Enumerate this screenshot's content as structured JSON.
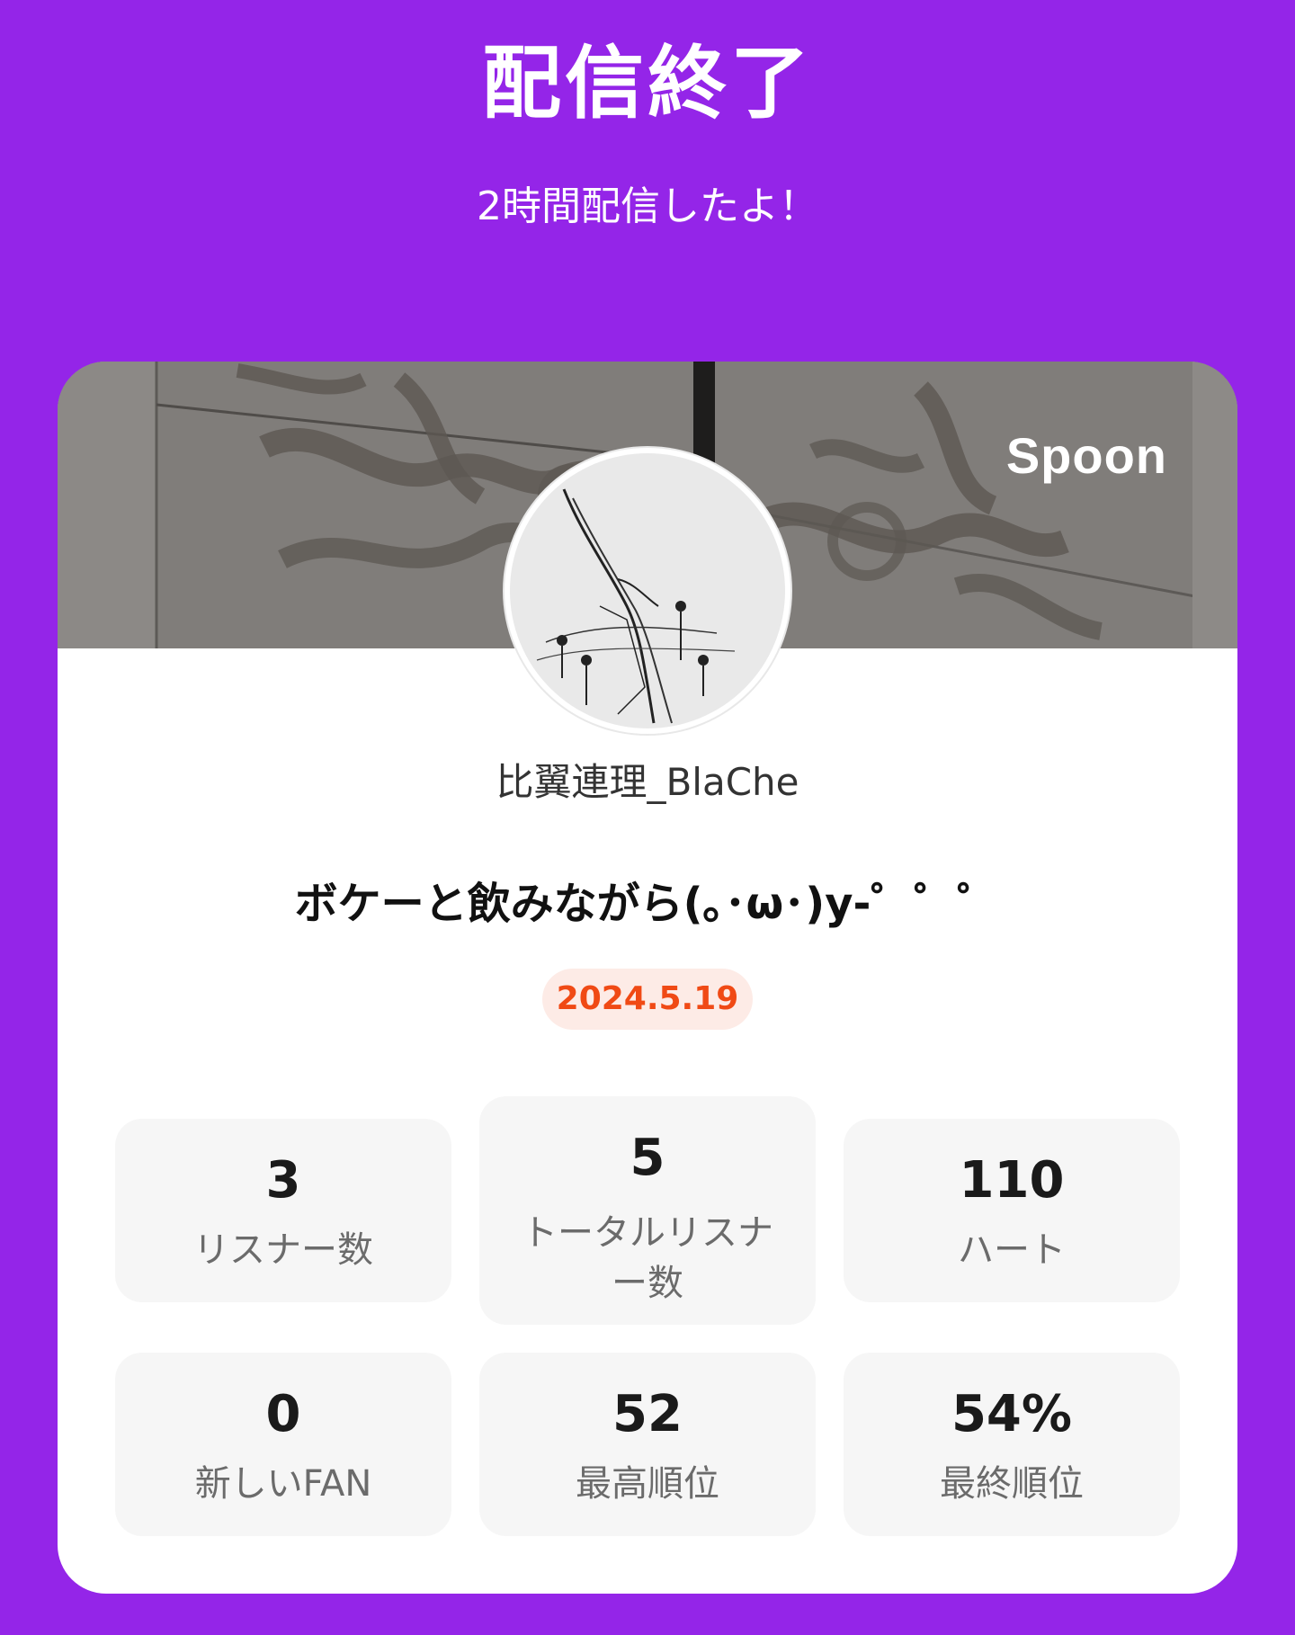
{
  "header": {
    "title": "配信終了",
    "subtitle": "2時間配信したよ！"
  },
  "card": {
    "brand": "Spoon",
    "username": "比翼連理_BlaChe",
    "live_title": "ボケーと飲みながら(｡･ω･)y-゜゜゜",
    "date": "2024.5.19"
  },
  "stats": [
    {
      "value": "3",
      "label": "リスナー数"
    },
    {
      "value": "5",
      "label": "トータルリスナー数"
    },
    {
      "value": "110",
      "label": "ハート"
    },
    {
      "value": "0",
      "label": "新しいFAN"
    },
    {
      "value": "52",
      "label": "最高順位"
    },
    {
      "value": "54%",
      "label": "最終順位"
    }
  ],
  "colors": {
    "background": "#9425E8",
    "date_badge_bg": "#FDEBE6",
    "date_badge_text": "#F04A15"
  },
  "icons": {
    "avatar": "profile-avatar-artwork",
    "banner": "banner-photo"
  }
}
